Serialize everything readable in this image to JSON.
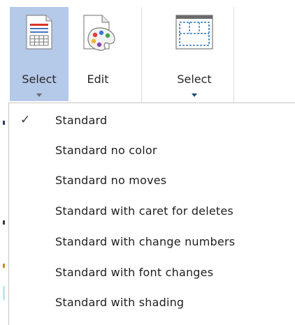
{
  "ribbon": {
    "select_markup_label": "Select",
    "edit_label": "Edit",
    "select_area_label": "Select"
  },
  "menu": {
    "items": [
      {
        "label": "Standard",
        "checked": true
      },
      {
        "label": "Standard no color",
        "checked": false
      },
      {
        "label": "Standard no moves",
        "checked": false
      },
      {
        "label": "Standard with caret for deletes",
        "checked": false
      },
      {
        "label": "Standard with change numbers",
        "checked": false
      },
      {
        "label": "Standard with font changes",
        "checked": false
      },
      {
        "label": "Standard with shading",
        "checked": false
      }
    ],
    "check_glyph": "✓"
  },
  "colors": {
    "selected_button_bg": "#b5c9e9",
    "menu_border": "#c6c6c6",
    "accent_blue": "#1f4e79"
  }
}
